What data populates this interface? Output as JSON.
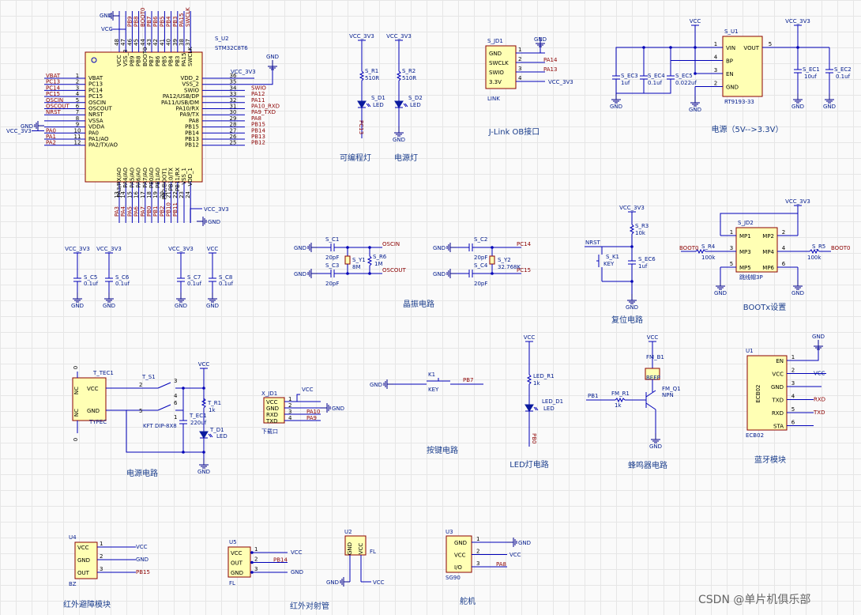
{
  "sections": {
    "prog_led": "可编程灯",
    "power_led": "电源灯",
    "jlink": "J-Link OB接口",
    "power": "电源（5V-->3.3V）",
    "crystal": "晶振电路",
    "reset": "复位电路",
    "boot": "BOOTx设置",
    "power_circuit": "电源电路",
    "key": "按键电路",
    "led": "LED灯电路",
    "buzzer": "蜂鸣器电路",
    "bluetooth": "蓝牙模块",
    "ir_avoid": "红外避障模块",
    "ir_pair": "红外对射管",
    "servo": "舵机"
  },
  "mcu": {
    "ref": "S_U2",
    "part": "STM32C8T6",
    "left_pins": [
      {
        "num": "1",
        "name": "VBAT",
        "net": "VBAT"
      },
      {
        "num": "2",
        "name": "PC13",
        "net": "PC13"
      },
      {
        "num": "3",
        "name": "PC14",
        "net": "PC14"
      },
      {
        "num": "4",
        "name": "PC15",
        "net": "PC15"
      },
      {
        "num": "5",
        "name": "OSCIN",
        "net": "OSCIN"
      },
      {
        "num": "6",
        "name": "OSCOUT",
        "net": "OSCOUT"
      },
      {
        "num": "7",
        "name": "NRST",
        "net": "NRST"
      },
      {
        "num": "8",
        "name": "VSSA",
        "net": ""
      },
      {
        "num": "9",
        "name": "VDDA",
        "net": ""
      },
      {
        "num": "10",
        "name": "PA0",
        "net": "PA0"
      },
      {
        "num": "11",
        "name": "PA1/AO",
        "net": "PA1"
      },
      {
        "num": "12",
        "name": "PA2/TX/AO",
        "net": "PA2"
      }
    ],
    "right_pins": [
      {
        "num": "36",
        "name": "VDD_2",
        "net": "VCC_3V3"
      },
      {
        "num": "35",
        "name": "VSS_2",
        "net": ""
      },
      {
        "num": "34",
        "name": "SWIO",
        "net": "SWIO"
      },
      {
        "num": "33",
        "name": "PA12/USB/DP",
        "net": "PA12"
      },
      {
        "num": "32",
        "name": "PA11/USB/DM",
        "net": "PA11"
      },
      {
        "num": "31",
        "name": "PA10/RX",
        "net": "PA10_RXD"
      },
      {
        "num": "30",
        "name": "PA9/TX",
        "net": "PA9_TXD"
      },
      {
        "num": "29",
        "name": "PA8",
        "net": "PA8"
      },
      {
        "num": "28",
        "name": "PB15",
        "net": "PB15"
      },
      {
        "num": "27",
        "name": "PB14",
        "net": "PB14"
      },
      {
        "num": "26",
        "name": "PB13",
        "net": "PB13"
      },
      {
        "num": "25",
        "name": "PB12",
        "net": "PB12"
      }
    ],
    "top_pins": [
      "VCC",
      "VSS_3",
      "PB9",
      "PB8",
      "BOOT0",
      "PB7",
      "PB6",
      "PB5",
      "PB4",
      "PB3",
      "PA15",
      "SWCLK"
    ],
    "top_nums": [
      "48",
      "47",
      "46",
      "45",
      "44",
      "43",
      "42",
      "41",
      "40",
      "39",
      "38",
      "37"
    ],
    "top_nets": [
      "",
      "",
      "PB9",
      "PB8",
      "BOOT0",
      "PB7",
      "PB6",
      "PB5",
      "PB4",
      "PB3",
      "PA15",
      "SWCLK"
    ],
    "bottom_pins": [
      "PA3/RX/AO",
      "PA4/AO",
      "PA5/AO",
      "PA6/AO",
      "PA7/AO",
      "PB0/AO",
      "PB1/AO",
      "PB2/BOOT1",
      "PB10/TX",
      "PB11/RX",
      "VSS_1",
      "VDD_1"
    ],
    "bottom_nums": [
      "13",
      "14",
      "15",
      "16",
      "17",
      "18",
      "19",
      "20",
      "21",
      "22",
      "23",
      "24"
    ],
    "bottom_nets": [
      "PA3",
      "PA4",
      "PA5",
      "PA6",
      "PA7",
      "PB0",
      "PB1",
      "PB2",
      "PB10",
      "PB11",
      "",
      ""
    ]
  },
  "labels": {
    "gnd": "GND",
    "vcc": "VCC",
    "vcc33": "VCC_3V3",
    "jlink_ref": "S_JD1",
    "jlink_part": "LINK",
    "jlink_pins": [
      {
        "num": "1",
        "name": "GND",
        "net": ""
      },
      {
        "num": "2",
        "name": "SWCLK",
        "net": "PA14"
      },
      {
        "num": "3",
        "name": "SWIO",
        "net": "PA13"
      },
      {
        "num": "4",
        "name": "3.3V",
        "net": "VCC_3V3"
      }
    ],
    "rd1": "S_R1",
    "rd1v": "510R",
    "d1": "S_D1",
    "d1t": "LED",
    "pc13": "PC13",
    "rd2": "S_R2",
    "rd2v": "510R",
    "d2": "S_D2",
    "d2t": "LED",
    "u1": "S_U1",
    "u1part": "RT9193-33",
    "u1_pins_l": [
      "VIN",
      "BP",
      "EN",
      "GND"
    ],
    "u1_pins_r": [
      "VOUT"
    ],
    "u1_nums_l": [
      "1",
      "4",
      "3",
      "2"
    ],
    "u1_nums_r": [
      "5"
    ],
    "ec3": "S_EC3",
    "ec3v": "1uf",
    "ec4": "S_EC4",
    "ec4v": "0.1uf",
    "ec5": "S_EC5",
    "ec5v": "0.022uf",
    "ec1": "S_EC1",
    "ec1v": "10uf",
    "ec2": "S_EC2",
    "ec2v": "0.1uf",
    "c5": "S_C5",
    "c5v": "0.1uf",
    "c6": "S_C6",
    "c6v": "0.1uf",
    "c7": "S_C7",
    "c7v": "0.1uf",
    "c8": "S_C8",
    "c8v": "0.1uf",
    "sc1": "S_C1",
    "sc1v": "20pF",
    "sc3": "S_C3",
    "sc3v": "20pF",
    "y1": "S_Y1",
    "y1v": "8M",
    "r6": "S_R6",
    "r6v": "1M",
    "oscin": "OSCIN",
    "oscout": "OSCOUT",
    "sc2": "S_C2",
    "sc2v": "20pF",
    "sc4": "S_C4",
    "sc4v": "20pF",
    "y2": "S_Y2",
    "y2v": "32.768K",
    "pc14": "PC14",
    "pc15": "PC15",
    "r3": "S_R3",
    "r3v": "10k",
    "nrst": "NRST",
    "k1": "S_K1",
    "k1t": "KEY",
    "ec6": "S_EC6",
    "ec6v": "1uf",
    "jd2": "S_JD2",
    "jd2part": "跳线帽3P",
    "jd2_l": [
      "MP1",
      "MP3",
      "MP5"
    ],
    "jd2_r": [
      "MP2",
      "MP4",
      "MP6"
    ],
    "jd2_nl": [
      "1",
      "3",
      "5"
    ],
    "jd2_nr": [
      "2",
      "4",
      "6"
    ],
    "r4": "S_R4",
    "r4v": "100k",
    "r5": "S_R5",
    "r5v": "100k",
    "boot0": "BOOT0",
    "tec1": "T_TEC1",
    "typec": "TYPEC",
    "tec_pins": [
      "VCC",
      "GND"
    ],
    "tec_side": [
      "NC",
      "NC"
    ],
    "s1": "T_S1",
    "s1part": "KFT DIP-8X8",
    "tr1": "T_R1",
    "tr1v": "1k",
    "tec": "T_EC1",
    "tecv": "220uf",
    "td1": "T_D1",
    "td1t": "LED",
    "xjd1": "X_JD1",
    "xjd1part": "下载口",
    "xjd_pins": [
      "VCC",
      "GND",
      "RXD",
      "TXD"
    ],
    "xjd_nets": [
      "",
      "",
      "PA10",
      "PA9"
    ],
    "key_k1": "K1",
    "key_t": "KEY",
    "pb7": "PB7",
    "ledr1": "LED_R1",
    "ledr1v": "1k",
    "ledd1": "LED_D1",
    "ledd1t": "LED",
    "pb0": "PB0",
    "fmb1": "FM_B1",
    "beep": "BEEP",
    "fmr1": "FM_R1",
    "fmr1v": "1k",
    "fmq1": "FM_Q1",
    "npn": "NPN",
    "pb1": "PB1",
    "bt_u1": "U1",
    "bt_part": "ECB02",
    "bt_pins": [
      "EN",
      "VCC",
      "GND",
      "TXD",
      "RXD",
      "STA"
    ],
    "bt_nets": [
      "",
      "VCC",
      "",
      "RXD",
      "TXD",
      ""
    ],
    "u4": "U4",
    "u4part": "BZ",
    "u4_pins": [
      "VCC",
      "GND",
      "OUT"
    ],
    "u4_nets": [
      "VCC",
      "GND",
      "PB15"
    ],
    "u5": "U5",
    "u5part": "FL",
    "u5_pins": [
      "VCC",
      "OUT",
      "GND"
    ],
    "u5_nets": [
      "VCC",
      "PB14",
      "GND"
    ],
    "u2": "U2",
    "u2part": "FL",
    "u2_pins": [
      "GND",
      "VCC"
    ],
    "u3": "U3",
    "u3part": "SG90",
    "u3_pins": [
      "GND",
      "VCC",
      "I/O"
    ],
    "u3_nets": [
      "GND",
      "VCC",
      "PA8"
    ]
  },
  "watermark": "CSDN @单片机俱乐部"
}
